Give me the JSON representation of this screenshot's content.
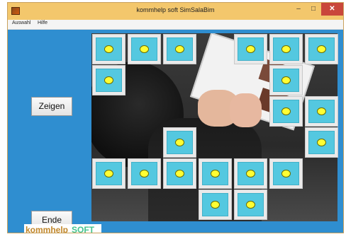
{
  "window": {
    "title": "kommhelp soft SimSalaBim"
  },
  "menu": {
    "items": [
      "Auswahl",
      "Hilfe"
    ]
  },
  "buttons": {
    "show": "Zeigen",
    "end": "Ende"
  },
  "logo": {
    "part1": "kommhelp",
    "part2": "SOFT"
  },
  "window_controls": {
    "minimize": "–",
    "maximize": "□",
    "close": "✕"
  },
  "tiles": {
    "row1": [
      "col1",
      "col2",
      "col3",
      "col5",
      "col6",
      "col7"
    ],
    "row2": [
      "col1",
      "col6"
    ],
    "row3": [
      "col6",
      "col7"
    ],
    "row4": [
      "col3",
      "col7"
    ],
    "row5": [
      "col1",
      "col2",
      "col3",
      "col4",
      "col5",
      "col6"
    ],
    "row6": [
      "col4",
      "col5"
    ]
  },
  "colors": {
    "background": "#2f8ed0",
    "tile": "#54c8e0",
    "dot": "#ffff33"
  }
}
